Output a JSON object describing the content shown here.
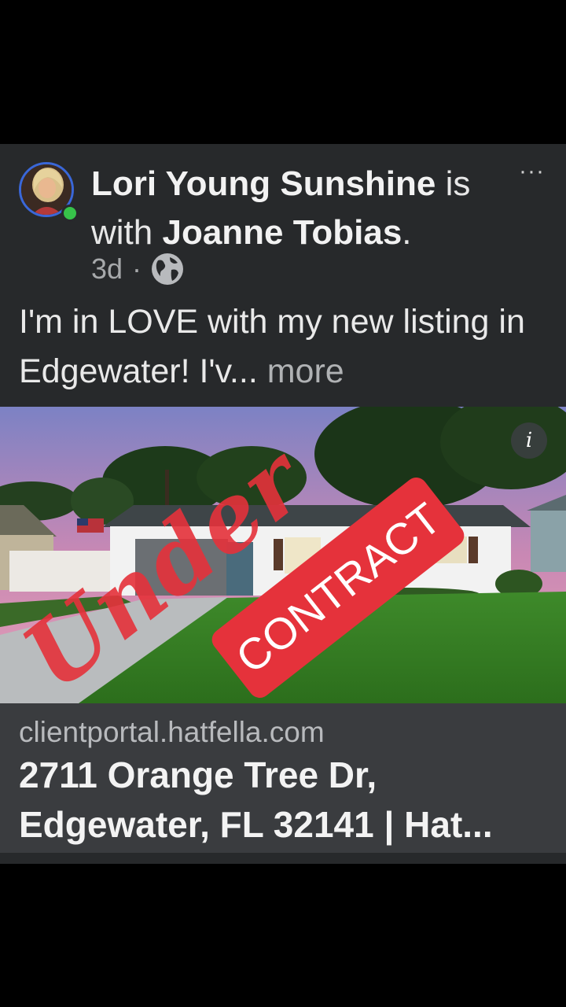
{
  "post": {
    "author": "Lori Young Sunshine",
    "is_text": "is",
    "with_text": "with",
    "tagged": "Joanne Tobias",
    "period": ".",
    "time": "3d",
    "separator": "·",
    "privacy_icon": "globe-icon",
    "body": "I'm in LOVE with my new listing in Edgewater! I'v...",
    "more_label": "more",
    "menu_icon": "more-dots-icon"
  },
  "image": {
    "overlay_script": "Under",
    "overlay_stamp": "CONTRACT",
    "info_icon": "i"
  },
  "link": {
    "domain": "clientportal.hatfella.com",
    "title": "2711 Orange Tree Dr, Edgewater, FL 32141 | Hat..."
  },
  "colors": {
    "background": "#000000",
    "card": "#27292b",
    "link_card": "#3a3c3f",
    "online": "#37c24a",
    "stamp_red": "#e5323b"
  }
}
